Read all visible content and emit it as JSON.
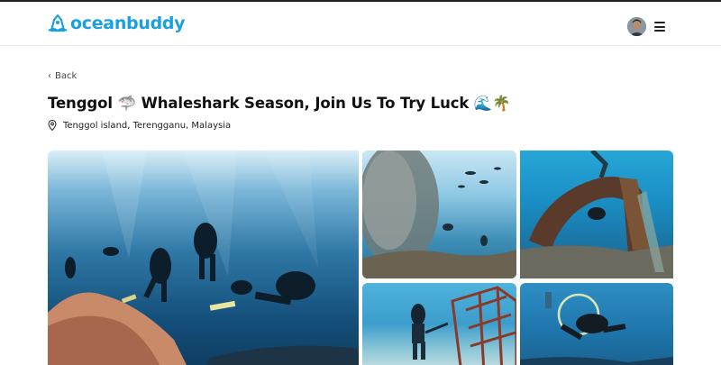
{
  "brand": {
    "name": "oceanbuddy",
    "color": "#1aa0e0"
  },
  "nav": {
    "avatar_icon": "user-avatar",
    "menu_icon": "hamburger-menu-icon"
  },
  "back": {
    "label": "Back"
  },
  "trip": {
    "title": "Tenggol 🦈 Whaleshark Season, Join Us To Try Luck 🌊🌴",
    "location": "Tenggol island, Terengganu, Malaysia"
  },
  "gallery": {
    "photos": [
      {
        "subject": "divers-over-coral-reef"
      },
      {
        "subject": "fish-school-with-diver"
      },
      {
        "subject": "shipwreck-diver"
      },
      {
        "subject": "diver-near-cage-structure"
      },
      {
        "subject": "diver-through-hoop"
      }
    ]
  }
}
